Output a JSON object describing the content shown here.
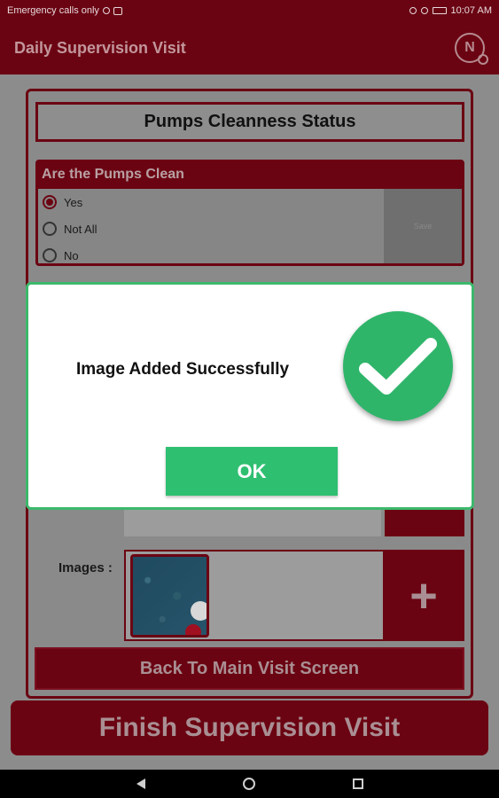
{
  "status_bar": {
    "left_text": "Emergency calls only",
    "time": "10:07 AM"
  },
  "app_bar": {
    "title": "Daily Supervision Visit",
    "logo_letter": "N"
  },
  "section": {
    "title": "Pumps Cleanness Status"
  },
  "question": {
    "title": "Are the Pumps Clean",
    "options": [
      {
        "label": "Yes",
        "selected": true
      },
      {
        "label": "Not All",
        "selected": false
      },
      {
        "label": "No",
        "selected": false
      }
    ],
    "save_label": "Save"
  },
  "images": {
    "label": "Images :",
    "add_glyph": "+"
  },
  "buttons": {
    "back_main": "Back To Main Visit Screen",
    "finish": "Finish Supervision Visit"
  },
  "dialog": {
    "message": "Image Added Successfully",
    "ok_label": "OK",
    "accent_color": "#2fbf71"
  },
  "colors": {
    "brand": "#6b0412"
  }
}
